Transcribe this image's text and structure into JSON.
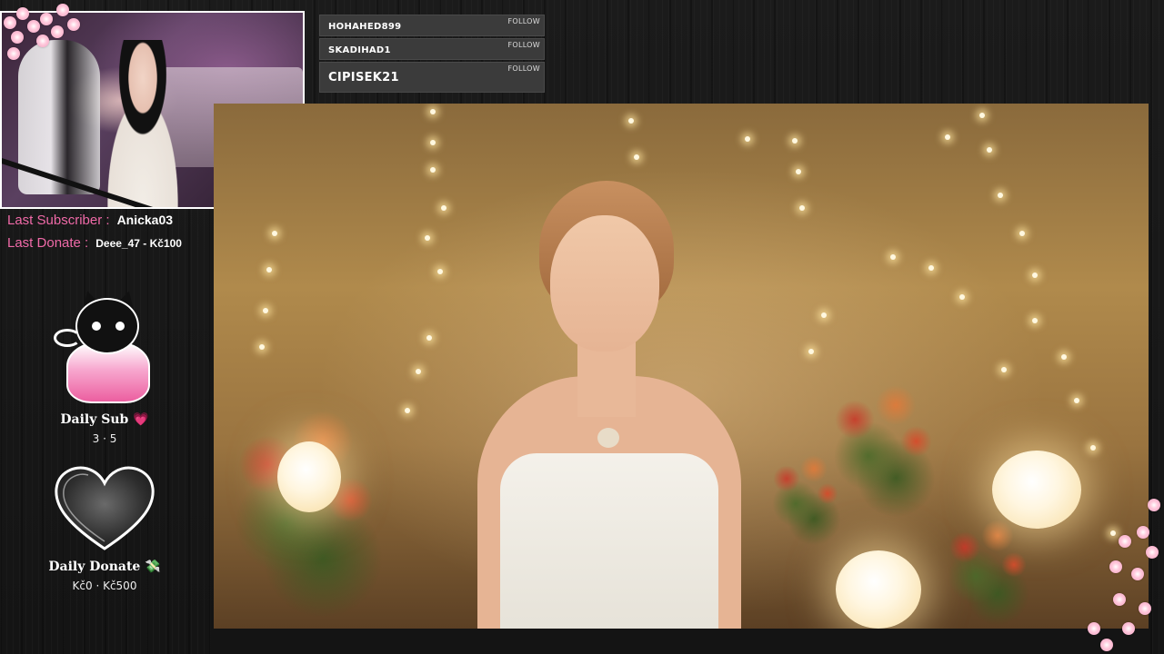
{
  "recent_follows": [
    {
      "name": "HOHAHED899",
      "tag": "FOLLOW"
    },
    {
      "name": "SKADIHAD1",
      "tag": "FOLLOW"
    },
    {
      "name": "CIPISEK21",
      "tag": "FOLLOW"
    }
  ],
  "stats": {
    "last_subscriber_label": "Last Subscriber :",
    "last_subscriber_value": "Anicka03",
    "last_donate_label": "Last Donate :",
    "last_donate_value": "Deee_47 - Kč100"
  },
  "daily_sub": {
    "title": "Daily Sub",
    "heart": "💗",
    "value": "3 · 5"
  },
  "daily_donate": {
    "title": "Daily Donate",
    "icon": "💸",
    "value": "Kč0 · Kč500"
  },
  "colors": {
    "accent_pink": "#f06aa8",
    "background": "#161616",
    "follow_row": "#3b3b3b"
  },
  "icons": {
    "cat_mascot": "cat-ghost-icon",
    "heart_frame": "heart-icon",
    "sakura": "sakura-icon"
  }
}
